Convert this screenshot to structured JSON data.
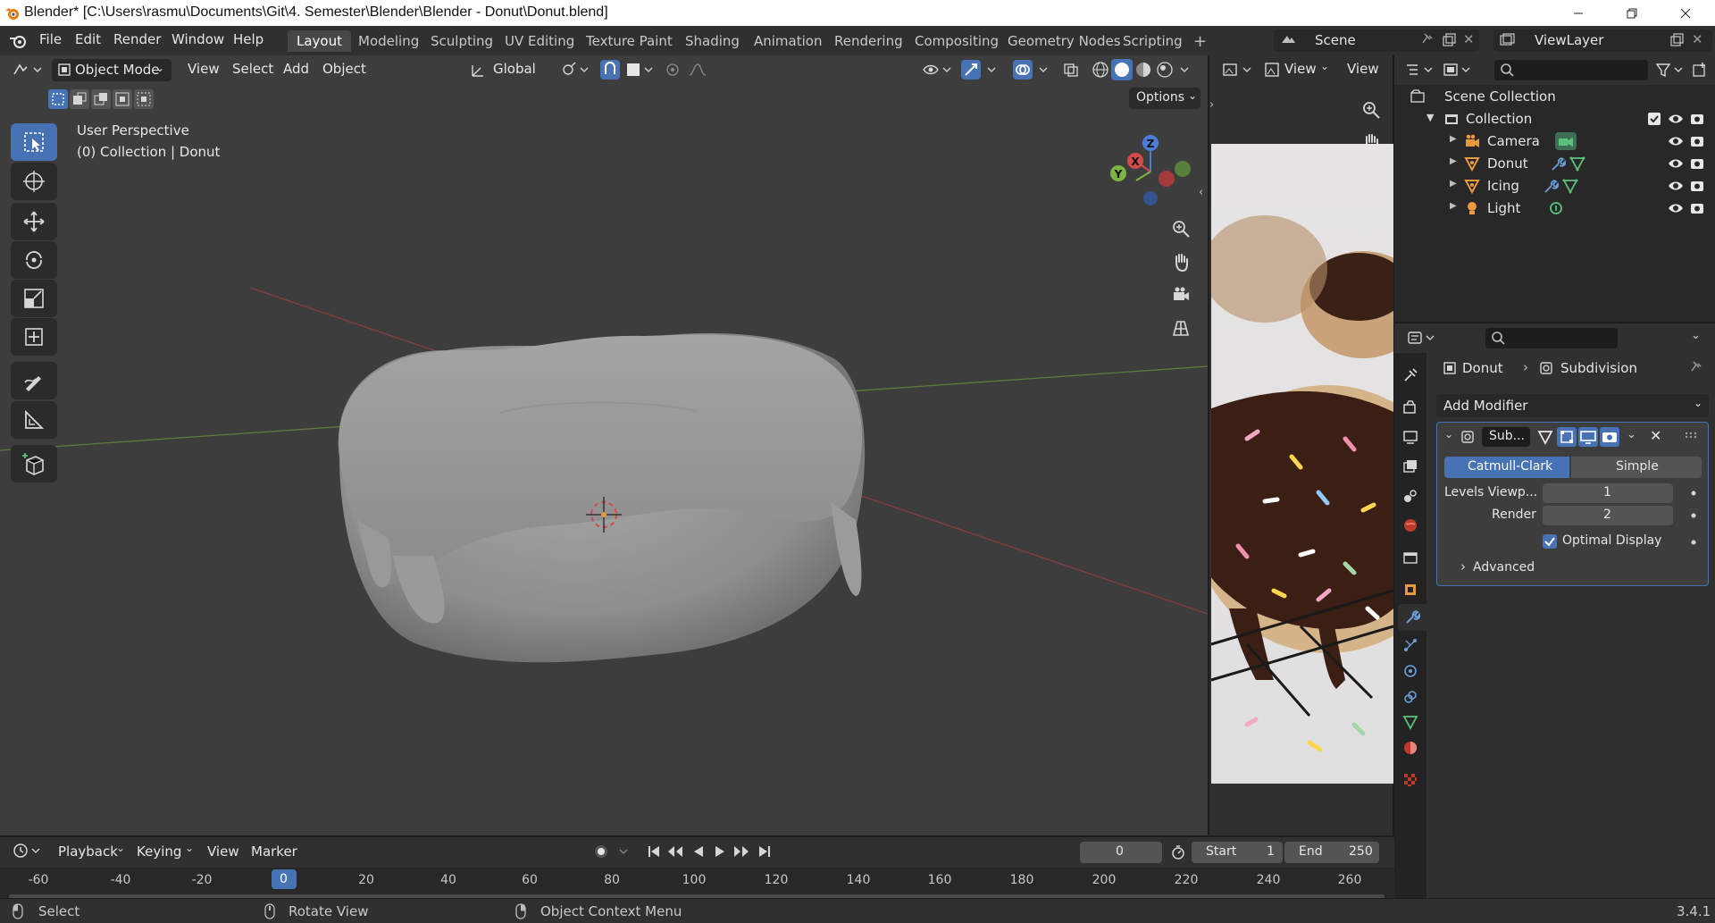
{
  "window": {
    "title": "Blender* [C:\\Users\\rasmu\\Documents\\Git\\4. Semester\\Blender\\Blender - Donut\\Donut.blend]"
  },
  "menu": [
    "File",
    "Edit",
    "Render",
    "Window",
    "Help"
  ],
  "workspaces": [
    "Layout",
    "Modeling",
    "Sculpting",
    "UV Editing",
    "Texture Paint",
    "Shading",
    "Animation",
    "Rendering",
    "Compositing",
    "Geometry Nodes",
    "Scripting"
  ],
  "active_workspace": "Layout",
  "scene_name": "Scene",
  "view_layer": "ViewLayer",
  "viewport": {
    "mode": "Object Mode",
    "menus": [
      "View",
      "Select",
      "Add",
      "Object"
    ],
    "orientation": "Global",
    "options": "Options",
    "overlay_title": "User Perspective",
    "overlay_subtitle": "(0) Collection | Donut"
  },
  "image_editor": {
    "view1": "View",
    "view2": "View"
  },
  "outliner": {
    "root": "Scene Collection",
    "collection": "Collection",
    "items": [
      {
        "name": "Camera"
      },
      {
        "name": "Donut"
      },
      {
        "name": "Icing"
      },
      {
        "name": "Light"
      }
    ]
  },
  "properties": {
    "breadcrumb_object": "Donut",
    "breadcrumb_modifier": "Subdivision",
    "add_modifier": "Add Modifier",
    "modifier_name": "Sub...",
    "subdiv_types": [
      "Catmull-Clark",
      "Simple"
    ],
    "active_type": "Catmull-Clark",
    "levels_label": "Levels Viewp...",
    "levels_value": "1",
    "render_label": "Render",
    "render_value": "2",
    "optimal_display": "Optimal Display",
    "optimal_checked": true,
    "advanced": "Advanced"
  },
  "timeline": {
    "menus": [
      "Playback",
      "Keying",
      "View",
      "Marker"
    ],
    "current_frame": "0",
    "start_label": "Start",
    "start": "1",
    "end_label": "End",
    "end": "250",
    "ticks": [
      "-60",
      "-40",
      "-20",
      "0",
      "20",
      "40",
      "60",
      "80",
      "100",
      "120",
      "140",
      "160",
      "180",
      "200",
      "220",
      "240",
      "260"
    ]
  },
  "status": {
    "select": "Select",
    "rotate": "Rotate View",
    "context": "Object Context Menu",
    "version": "3.4.1"
  },
  "colors": {
    "accent": "#4772b3",
    "object_orange": "#e89a3c",
    "modifier_blue": "#6b9fd8",
    "data_green": "#5cc17a"
  }
}
